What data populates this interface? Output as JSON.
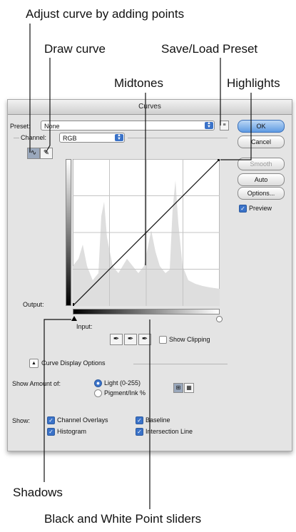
{
  "callouts": {
    "adjust_curve": "Adjust curve by adding points",
    "draw_curve": "Draw curve",
    "save_load_preset": "Save/Load Preset",
    "midtones": "Midtones",
    "highlights": "Highlights",
    "shadows": "Shadows",
    "bw_sliders": "Black and White Point sliders"
  },
  "dialog": {
    "title": "Curves",
    "preset_label": "Preset:",
    "preset_value": "None",
    "channel_label": "Channel:",
    "channel_value": "RGB",
    "output_label": "Output:",
    "input_label": "Input:",
    "show_clipping": "Show Clipping",
    "curve_display_options": "Curve Display Options",
    "show_amount_label": "Show Amount of:",
    "light_option": "Light  (0-255)",
    "pigment_option": "Pigment/Ink %",
    "show_label": "Show:",
    "channel_overlays": "Channel Overlays",
    "baseline": "Baseline",
    "histogram": "Histogram",
    "intersection_line": "Intersection Line",
    "preview": "Preview",
    "buttons": {
      "ok": "OK",
      "cancel": "Cancel",
      "smooth": "Smooth",
      "auto": "Auto",
      "options": "Options..."
    },
    "state": {
      "show_clipping": false,
      "preview": true,
      "channel_overlays": true,
      "baseline": true,
      "histogram": true,
      "intersection_line": true,
      "amount_mode": "light"
    }
  }
}
